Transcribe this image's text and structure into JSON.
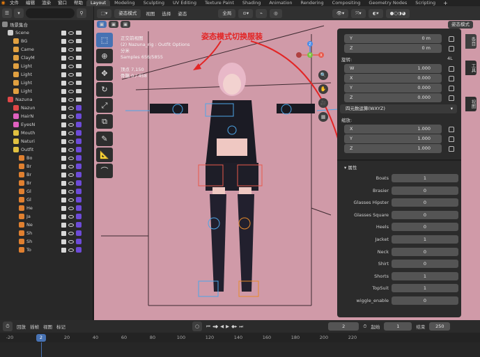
{
  "topbar": {
    "menus": [
      "文件",
      "编辑",
      "渲染",
      "窗口",
      "帮助"
    ],
    "workspace_tabs": [
      "Layout",
      "Modeling",
      "Sculpting",
      "UV Editing",
      "Texture Paint",
      "Shading",
      "Animation",
      "Rendering",
      "Compositing",
      "Geometry Nodes",
      "Scripting"
    ],
    "active_tab": "Layout"
  },
  "outliner": {
    "header_icon": "☰",
    "search_placeholder": "",
    "rows": [
      {
        "label": "场景集合",
        "indent": 0,
        "color": "#888888"
      },
      {
        "label": "Scene",
        "indent": 1,
        "color": "#cccccc"
      },
      {
        "label": "BG",
        "indent": 2,
        "color": "#e0a040"
      },
      {
        "label": "Came",
        "indent": 2,
        "color": "#e0a040"
      },
      {
        "label": "ClayM",
        "indent": 2,
        "color": "#e0a040"
      },
      {
        "label": "Light",
        "indent": 2,
        "color": "#e0a040"
      },
      {
        "label": "Light",
        "indent": 2,
        "color": "#e0a040"
      },
      {
        "label": "Light",
        "indent": 2,
        "color": "#e0a040"
      },
      {
        "label": "Light",
        "indent": 2,
        "color": "#e0a040"
      },
      {
        "label": "Nazuna",
        "indent": 1,
        "color": "#e04848"
      },
      {
        "label": "Nazun",
        "indent": 2,
        "color": "#e04848"
      },
      {
        "label": "HairN",
        "indent": 2,
        "color": "#e060c0"
      },
      {
        "label": "EyesN",
        "indent": 2,
        "color": "#e060c0"
      },
      {
        "label": "Mouth",
        "indent": 2,
        "color": "#e0c040"
      },
      {
        "label": "Naturi",
        "indent": 2,
        "color": "#e0c040"
      },
      {
        "label": "Outfit",
        "indent": 2,
        "color": "#e0c040"
      },
      {
        "label": "Bo",
        "indent": 3,
        "color": "#e08030"
      },
      {
        "label": "Br",
        "indent": 3,
        "color": "#e08030"
      },
      {
        "label": "Br",
        "indent": 3,
        "color": "#e08030"
      },
      {
        "label": "Br",
        "indent": 3,
        "color": "#e08030"
      },
      {
        "label": "Gl",
        "indent": 3,
        "color": "#e08030"
      },
      {
        "label": "Gl",
        "indent": 3,
        "color": "#e08030"
      },
      {
        "label": "He",
        "indent": 3,
        "color": "#e08030"
      },
      {
        "label": "Ja",
        "indent": 3,
        "color": "#e08030"
      },
      {
        "label": "Ne",
        "indent": 3,
        "color": "#e08030"
      },
      {
        "label": "Sh",
        "indent": 3,
        "color": "#e08030"
      },
      {
        "label": "Sh",
        "indent": 3,
        "color": "#e08030"
      },
      {
        "label": "To",
        "indent": 3,
        "color": "#e08030"
      }
    ]
  },
  "viewport": {
    "mode": "姿态模式",
    "menus": [
      "视图",
      "选择",
      "姿态"
    ],
    "transform_orientation": "全局",
    "view_selector": "姿态模式",
    "overlay": [
      "正交前视图",
      "(2) Nazuna_rig : Outfit Options",
      "分米",
      "Samples 656/5855",
      "",
      "顶点      7,150",
      "骨骼      0 / 458"
    ],
    "annotation": "姿态模式切换服装",
    "gizmo": {
      "x_label": "X",
      "y_label": "Y",
      "z_label": "Z"
    }
  },
  "npanel": {
    "location": [
      {
        "axis": "Y",
        "value": "0 m"
      },
      {
        "axis": "Z",
        "value": "0 m"
      }
    ],
    "rotation_label": "旋转:",
    "rotation_mode_short": "4L",
    "rotation": [
      {
        "axis": "W",
        "value": "1.000"
      },
      {
        "axis": "X",
        "value": "0.000"
      },
      {
        "axis": "Y",
        "value": "0.000"
      },
      {
        "axis": "Z",
        "value": "0.000"
      }
    ],
    "rotation_mode": "四元数运算(WXYZ)",
    "scale_label": "缩放:",
    "scale": [
      {
        "axis": "X",
        "value": "1.000"
      },
      {
        "axis": "Y",
        "value": "1.000"
      },
      {
        "axis": "Z",
        "value": "1.000"
      }
    ],
    "properties_title": "属性",
    "properties": [
      {
        "name": "Boats",
        "value": "1"
      },
      {
        "name": "Brasier",
        "value": "0"
      },
      {
        "name": "Glasses Hipster",
        "value": "0"
      },
      {
        "name": "Glasses Square",
        "value": "0"
      },
      {
        "name": "Heels",
        "value": "0"
      },
      {
        "name": "Jacket",
        "value": "1"
      },
      {
        "name": "Neck",
        "value": "0"
      },
      {
        "name": "Shirt",
        "value": "0"
      },
      {
        "name": "Shorts",
        "value": "1"
      },
      {
        "name": "TopSuit",
        "value": "1"
      },
      {
        "name": "wiggle_enable",
        "value": "0"
      }
    ],
    "side_tabs": [
      "条目",
      "工具",
      "视图"
    ]
  },
  "timeline": {
    "menus": [
      "回放",
      "插帧",
      "视图",
      "标记"
    ],
    "current_frame": "2",
    "start_label": "起始",
    "start": "1",
    "end_label": "结束",
    "end": "250",
    "ticks": [
      "-20",
      "0",
      "20",
      "40",
      "60",
      "80",
      "100",
      "120",
      "140",
      "160",
      "180",
      "200",
      "220"
    ],
    "playhead": "2"
  },
  "colors": {
    "viewport_bg": "#d09aa8",
    "accent": "#4772b3",
    "annotation": "#e32525"
  }
}
